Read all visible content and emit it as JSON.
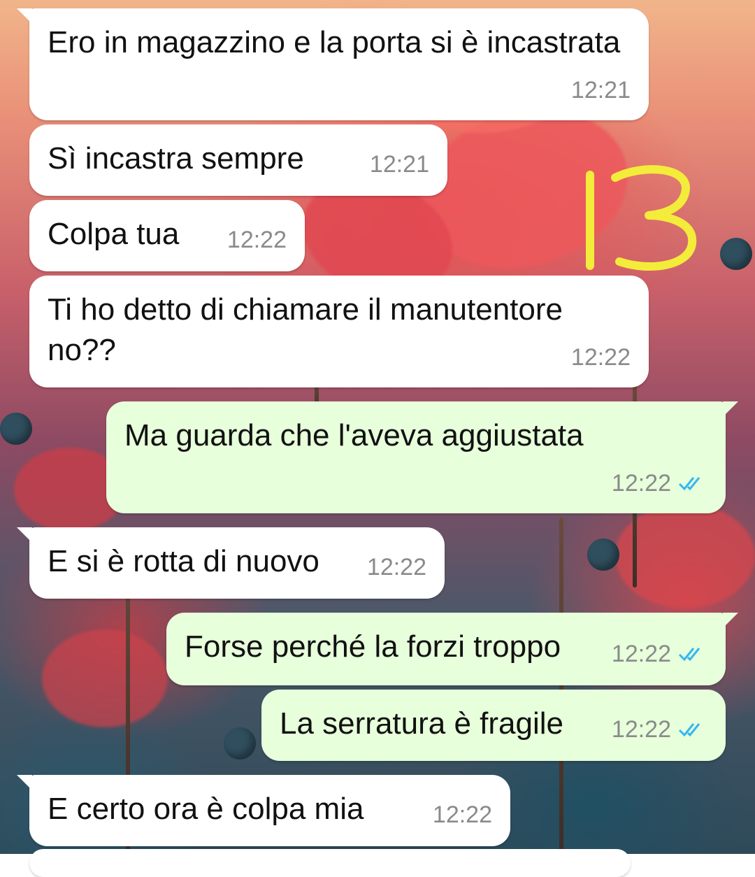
{
  "messages": [
    {
      "text": "Ero in magazzino e la porta si è incastrata",
      "time": "12:21",
      "direction": "in"
    },
    {
      "text": "Sì incastra sempre",
      "time": "12:21",
      "direction": "in"
    },
    {
      "text": "Colpa tua",
      "time": "12:22",
      "direction": "in"
    },
    {
      "text": "Ti ho detto di chiamare il manutentore no??",
      "time": "12:22",
      "direction": "in"
    },
    {
      "text": "Ma guarda che l'aveva aggiustata",
      "time": "12:22",
      "direction": "out",
      "status": "read"
    },
    {
      "text": "E si è rotta di nuovo",
      "time": "12:22",
      "direction": "in"
    },
    {
      "text": "Forse perché la forzi troppo",
      "time": "12:22",
      "direction": "out",
      "status": "read"
    },
    {
      "text": "La serratura è fragile",
      "time": "12:22",
      "direction": "out",
      "status": "read"
    },
    {
      "text": "E certo ora è colpa mia",
      "time": "12:22",
      "direction": "in"
    }
  ],
  "annotation": {
    "text": "13",
    "color": "#f4ec3a"
  },
  "colors": {
    "incoming_bubble": "#ffffff",
    "outgoing_bubble": "#e7ffdb",
    "read_check": "#34b7f1",
    "timestamp": "#8a8a8a"
  },
  "icons": {
    "read_receipt": "double-check-icon"
  }
}
